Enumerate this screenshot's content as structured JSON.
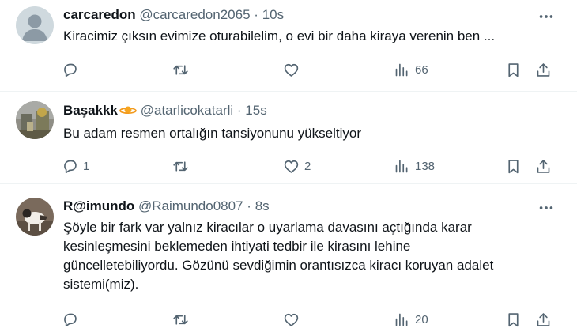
{
  "tweets": [
    {
      "display_name": "carcaredon",
      "handle": "@carcaredon2065",
      "dot": "·",
      "time": "10s",
      "text": "Kiracimiz çıksın evimize oturabilelim,  o evi bir daha kiraya verenin ben ...",
      "replies": "",
      "retweets": "",
      "likes": "",
      "views": "66"
    },
    {
      "display_name": "Başakkk",
      "handle": "@atarlicokatarli",
      "dot": "·",
      "time": "15s",
      "text": "Bu adam resmen ortalığın tansiyonunu yükseltiyor",
      "replies": "1",
      "retweets": "",
      "likes": "2",
      "views": "138"
    },
    {
      "display_name": "R@imundo",
      "handle": "@Raimundo0807",
      "dot": "·",
      "time": "8s",
      "text": "Şöyle bir fark var yalnız kiracılar o uyarlama davasını açtığında karar kesinleşmesini beklemeden ihtiyati tedbir ile kirasını lehine güncelletebiliyordu. Gözünü sevdiğimin orantısızca kiracı koruyan adalet sistemi(miz).",
      "replies": "",
      "retweets": "",
      "likes": "",
      "views": "20"
    }
  ],
  "icons": {
    "more": "more-horizontal-icon",
    "reply": "reply-icon",
    "retweet": "retweet-icon",
    "like": "heart-icon",
    "views": "views-chart-icon",
    "bookmark": "bookmark-icon",
    "share": "share-icon",
    "name_emoji": "orange-planet-emoji-icon"
  },
  "colors": {
    "text": "#0f1419",
    "secondary": "#536471",
    "divider": "#eff3f4",
    "default_avatar_bg": "#cfd9de"
  }
}
